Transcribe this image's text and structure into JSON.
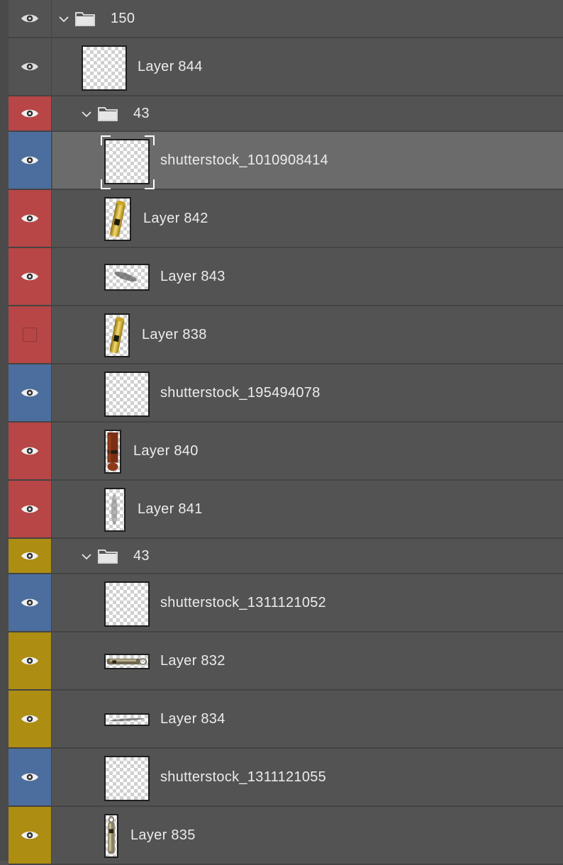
{
  "colors": {
    "red": "#b84646",
    "blue": "#4c6e9e",
    "yellow": "#ad8d12",
    "none": "#535353"
  },
  "layers": [
    {
      "name": "150",
      "type": "group",
      "indent": 0,
      "tag": "none",
      "visible": true
    },
    {
      "name": "Layer 844",
      "type": "layer",
      "thumb": "transparent",
      "tag": "none",
      "visible": true
    },
    {
      "name": "43",
      "type": "group",
      "indent": 1,
      "tag": "red",
      "visible": true
    },
    {
      "name": "shutterstock_1010908414",
      "type": "layer",
      "thumb": "transparent",
      "tag": "blue",
      "visible": true,
      "selected": true
    },
    {
      "name": "Layer 842",
      "type": "layer",
      "thumb": "gold-whistle",
      "tag": "red",
      "visible": true
    },
    {
      "name": "Layer 843",
      "type": "layer",
      "thumb": "shadow",
      "tag": "red",
      "visible": true
    },
    {
      "name": "Layer 838",
      "type": "layer",
      "thumb": "gold-whistle",
      "tag": "red",
      "visible": false
    },
    {
      "name": "shutterstock_195494078",
      "type": "layer",
      "thumb": "transparent",
      "tag": "blue",
      "visible": true
    },
    {
      "name": "Layer 840",
      "type": "layer",
      "thumb": "wood-whistle",
      "tag": "red",
      "visible": true
    },
    {
      "name": "Layer 841",
      "type": "layer",
      "thumb": "vertical-shadow",
      "tag": "red",
      "visible": true
    },
    {
      "name": "43",
      "type": "group",
      "indent": 1,
      "tag": "yellow",
      "visible": true
    },
    {
      "name": "shutterstock_1311121052",
      "type": "layer",
      "thumb": "transparent",
      "tag": "blue",
      "visible": true
    },
    {
      "name": "Layer 832",
      "type": "layer",
      "thumb": "metal-whistle-horizontal",
      "tag": "yellow",
      "visible": true
    },
    {
      "name": "Layer 834",
      "type": "layer",
      "thumb": "thin-shadow",
      "tag": "yellow",
      "visible": true
    },
    {
      "name": "shutterstock_1311121055",
      "type": "layer",
      "thumb": "transparent",
      "tag": "blue",
      "visible": true
    },
    {
      "name": "Layer 835",
      "type": "layer",
      "thumb": "metal-whistle-vertical",
      "tag": "yellow",
      "visible": true
    }
  ]
}
